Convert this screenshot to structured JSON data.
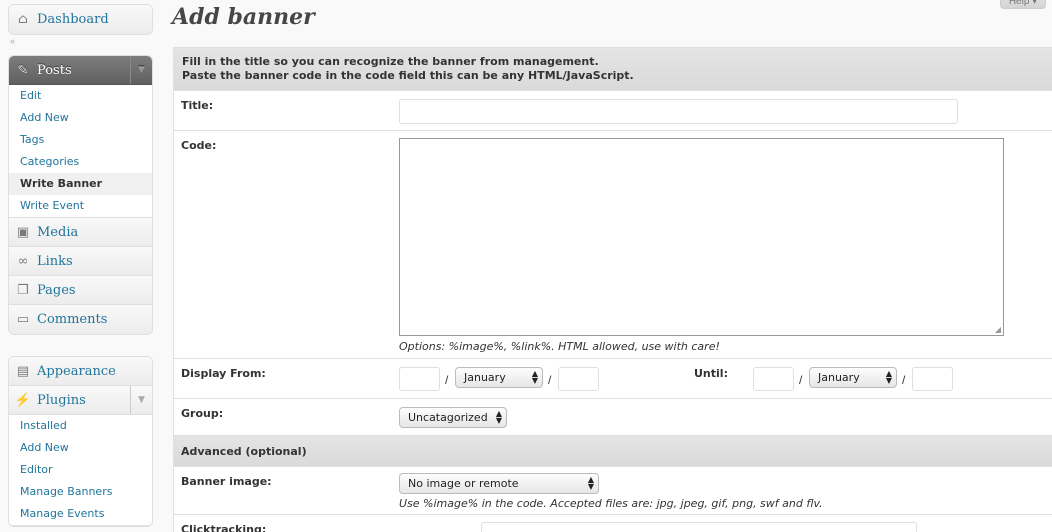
{
  "sidebar": {
    "dashboard": "Dashboard",
    "posts": {
      "label": "Posts",
      "items": [
        "Edit",
        "Add New",
        "Tags",
        "Categories",
        "Write Banner",
        "Write Event"
      ]
    },
    "media": "Media",
    "links": "Links",
    "pages": "Pages",
    "comments": "Comments",
    "appearance": "Appearance",
    "plugins": {
      "label": "Plugins",
      "items": [
        "Installed",
        "Add New",
        "Editor",
        "Manage Banners",
        "Manage Events"
      ]
    }
  },
  "help_tab": "Help ▾",
  "page_title": "Add banner",
  "intro": {
    "line1": "Fill in the title so you can recognize the banner from management.",
    "line2": "Paste the banner code in the code field this can be any HTML/JavaScript."
  },
  "form": {
    "title_label": "Title:",
    "title_value": "",
    "code_label": "Code:",
    "code_hint": "Options: %image%, %link%. HTML allowed, use with care!",
    "display_from_label": "Display From:",
    "from_month": "January",
    "until_label": "Until:",
    "until_month": "January",
    "slash": "/",
    "group_label": "Group:",
    "group_value": "Uncatagorized",
    "advanced_label": "Advanced (optional)",
    "banner_image_label": "Banner image:",
    "banner_image_value": "No image or remote",
    "banner_image_hint": "Use %image% in the code. Accepted files are: jpg, jpeg, gif, png, swf and flv.",
    "clicktracking_label": "Clicktracking:"
  }
}
